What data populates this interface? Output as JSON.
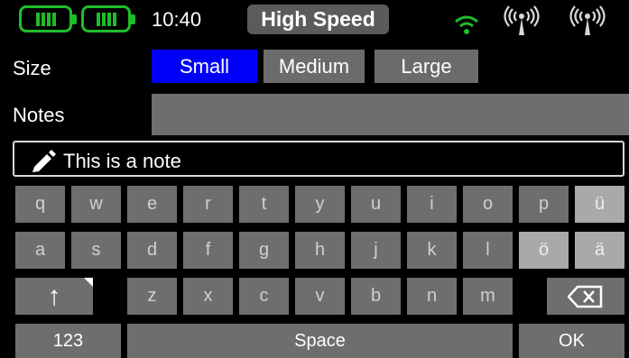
{
  "status": {
    "time": "10:40",
    "mode": "High Speed",
    "icons": [
      "battery-icon",
      "battery-icon",
      "wifi-icon",
      "antenna-icon",
      "antenna-icon"
    ],
    "accent_color": "#1fbd2a"
  },
  "size": {
    "label": "Size",
    "options": [
      "Small",
      "Medium",
      "Large"
    ],
    "selected": "Small",
    "selected_color": "#0000f8"
  },
  "notes": {
    "label": "Notes",
    "value": "",
    "note_text": "This is a note",
    "note_icon": "pencil-icon"
  },
  "keyboard": {
    "row1": [
      "q",
      "w",
      "e",
      "r",
      "t",
      "y",
      "u",
      "i",
      "o",
      "p",
      "ü"
    ],
    "row2": [
      "a",
      "s",
      "d",
      "f",
      "g",
      "h",
      "j",
      "k",
      "l",
      "ö",
      "ä"
    ],
    "row3": [
      "z",
      "x",
      "c",
      "v",
      "b",
      "n",
      "m"
    ],
    "shift_symbol": "↑",
    "numbers_label": "123",
    "space_label": "Space",
    "ok_label": "OK",
    "backspace_icon": "backspace-icon"
  }
}
